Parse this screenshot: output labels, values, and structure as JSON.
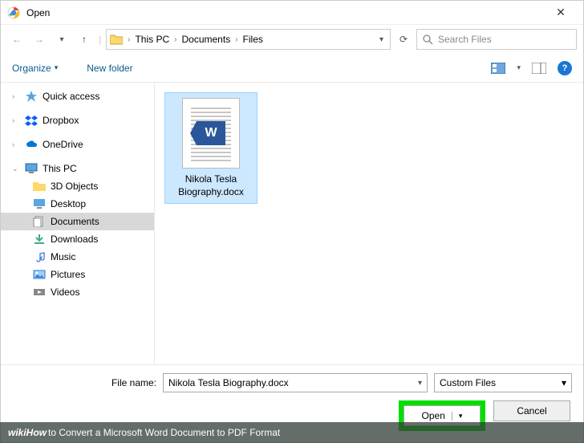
{
  "window": {
    "title": "Open",
    "close_glyph": "✕"
  },
  "nav": {
    "back": "←",
    "forward": "→",
    "up": "↑",
    "refresh": "⟳",
    "breadcrumbs": [
      "This PC",
      "Documents",
      "Files"
    ],
    "search_placeholder": "Search Files"
  },
  "toolbar": {
    "organize": "Organize",
    "new_folder": "New folder"
  },
  "sidebar": {
    "quick_access": "Quick access",
    "dropbox": "Dropbox",
    "onedrive": "OneDrive",
    "this_pc": "This PC",
    "children": [
      "3D Objects",
      "Desktop",
      "Documents",
      "Downloads",
      "Music",
      "Pictures",
      "Videos"
    ]
  },
  "content": {
    "files": [
      {
        "name": "Nikola Tesla Biography.docx"
      }
    ]
  },
  "footer": {
    "filename_label": "File name:",
    "filename_value": "Nikola Tesla Biography.docx",
    "filter": "Custom Files",
    "open": "Open",
    "cancel": "Cancel"
  },
  "caption": {
    "brand": "wikiHow",
    "text": " to Convert a Microsoft Word Document to PDF Format"
  }
}
